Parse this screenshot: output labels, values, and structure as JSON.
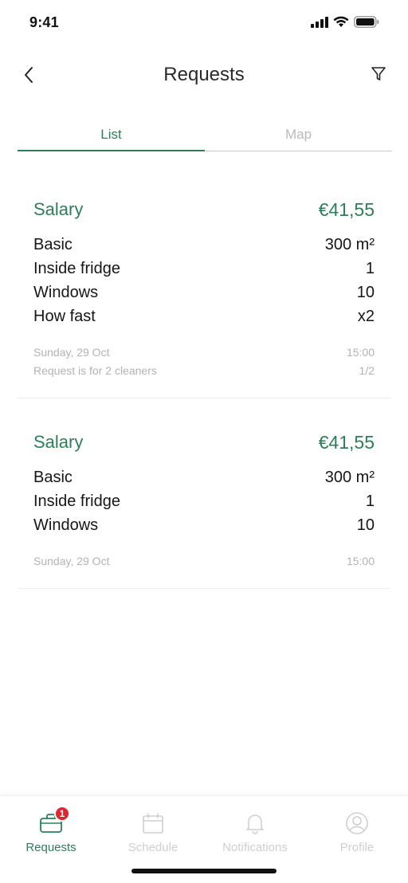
{
  "status": {
    "time": "9:41"
  },
  "nav": {
    "title": "Requests"
  },
  "tabs": [
    {
      "label": "List",
      "active": true
    },
    {
      "label": "Map",
      "active": false
    }
  ],
  "requests": [
    {
      "title": "Salary",
      "price": "€41,55",
      "items": [
        {
          "label": "Basic",
          "value": "300 m²"
        },
        {
          "label": "Inside fridge",
          "value": "1"
        },
        {
          "label": "Windows",
          "value": "10"
        },
        {
          "label": "How fast",
          "value": "x2"
        }
      ],
      "date": "Sunday, 29 Oct",
      "time": "15:00",
      "note": "Request is for 2 cleaners",
      "cleaners": "1/2"
    },
    {
      "title": "Salary",
      "price": "€41,55",
      "items": [
        {
          "label": "Basic",
          "value": "300 m²"
        },
        {
          "label": "Inside fridge",
          "value": "1"
        },
        {
          "label": "Windows",
          "value": "10"
        }
      ],
      "date": "Sunday, 29 Oct",
      "time": "15:00"
    }
  ],
  "tabbar": {
    "items": [
      {
        "label": "Requests",
        "icon": "briefcase-icon",
        "active": true,
        "badge": "1"
      },
      {
        "label": "Schedule",
        "icon": "calendar-icon",
        "active": false
      },
      {
        "label": "Notifications",
        "icon": "bell-icon",
        "active": false
      },
      {
        "label": "Profile",
        "icon": "profile-icon",
        "active": false
      }
    ]
  },
  "colors": {
    "accent": "#2e7d5b",
    "badge": "#e0252f",
    "muted": "#b3b3b3"
  }
}
